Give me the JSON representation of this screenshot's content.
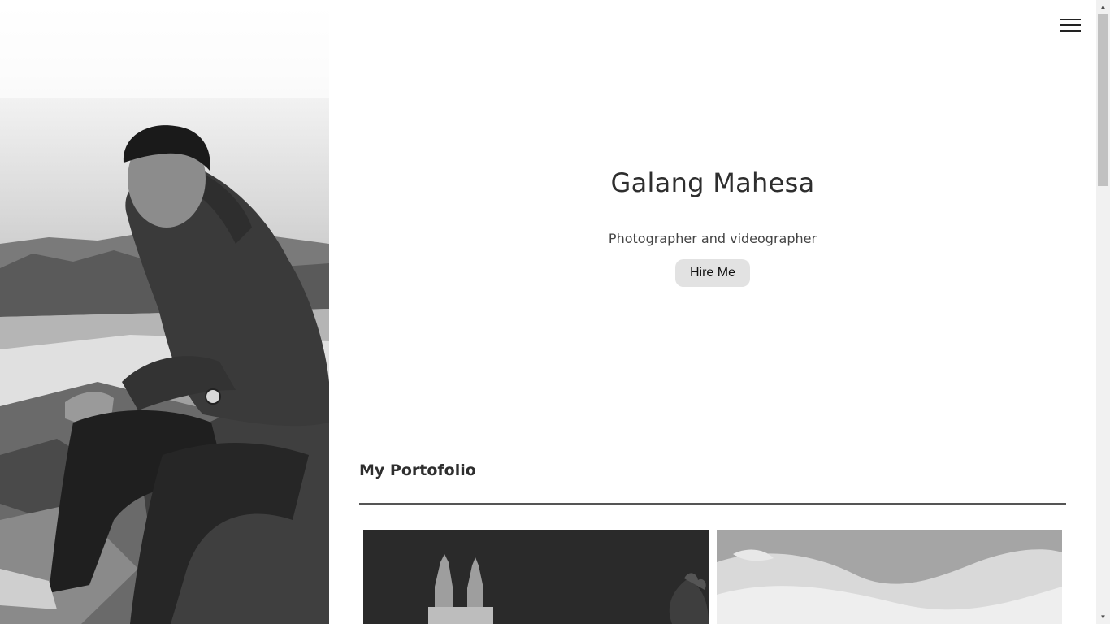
{
  "header": {
    "menu_icon": "hamburger-menu-icon"
  },
  "hero": {
    "photo": "portrait-photo",
    "name": "Galang Mahesa",
    "tagline": "Photographer and videographer",
    "cta_label": "Hire Me"
  },
  "portfolio": {
    "title": "My Portofolio",
    "items": [
      {
        "photo": "church-night-photo"
      },
      {
        "photo": "cloudy-sky-photo"
      }
    ]
  },
  "colors": {
    "background": "#ffffff",
    "text": "#2e2e2e",
    "button_bg": "#e2e2e2",
    "divider": "#555555"
  }
}
